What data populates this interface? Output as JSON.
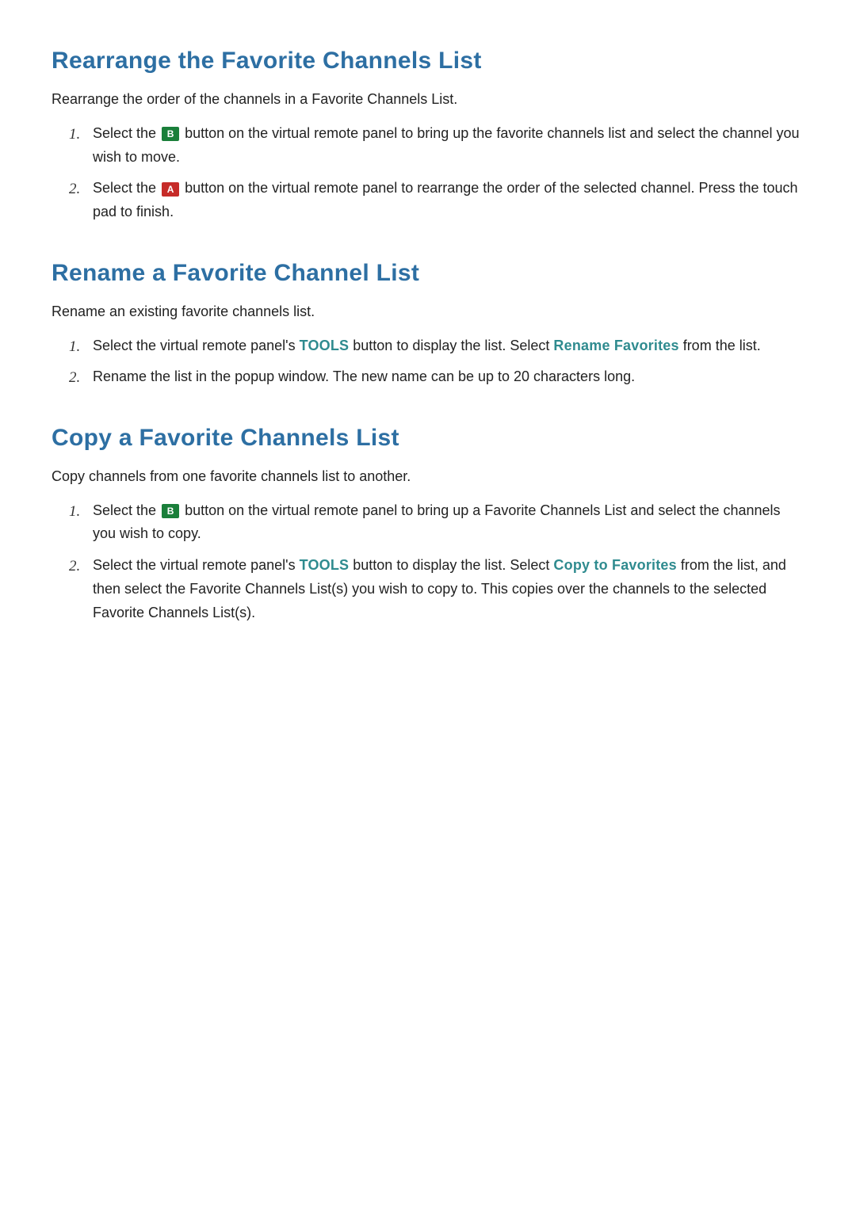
{
  "buttons": {
    "b": "B",
    "a": "A"
  },
  "sections": {
    "rearrange": {
      "heading": "Rearrange the Favorite Channels List",
      "intro": "Rearrange the order of the channels in a Favorite Channels List.",
      "step1_pre": "Select the ",
      "step1_post": " button on the virtual remote panel to bring up the favorite channels list and select the channel you wish to move.",
      "step2_pre": "Select the ",
      "step2_post": " button on the virtual remote panel to rearrange the order of the selected channel. Press the touch pad to finish."
    },
    "rename": {
      "heading": "Rename a Favorite Channel List",
      "intro": "Rename an existing favorite channels list.",
      "step1_pre": "Select the virtual remote panel's ",
      "step1_tools": "TOOLS",
      "step1_mid": " button to display the list. Select ",
      "step1_action": "Rename Favorites",
      "step1_post": " from the list.",
      "step2": "Rename the list in the popup window. The new name can be up to 20 characters long."
    },
    "copy": {
      "heading": "Copy a Favorite Channels List",
      "intro": "Copy channels from one favorite channels list to another.",
      "step1_pre": "Select the ",
      "step1_post": " button on the virtual remote panel to bring up a Favorite Channels List and select the channels you wish to copy.",
      "step2_pre": "Select the virtual remote panel's ",
      "step2_tools": "TOOLS",
      "step2_mid": " button to display the list. Select ",
      "step2_action": "Copy to Favorites",
      "step2_post": " from the list, and then select the Favorite Channels List(s) you wish to copy to. This copies over the channels to the selected Favorite Channels List(s)."
    }
  }
}
